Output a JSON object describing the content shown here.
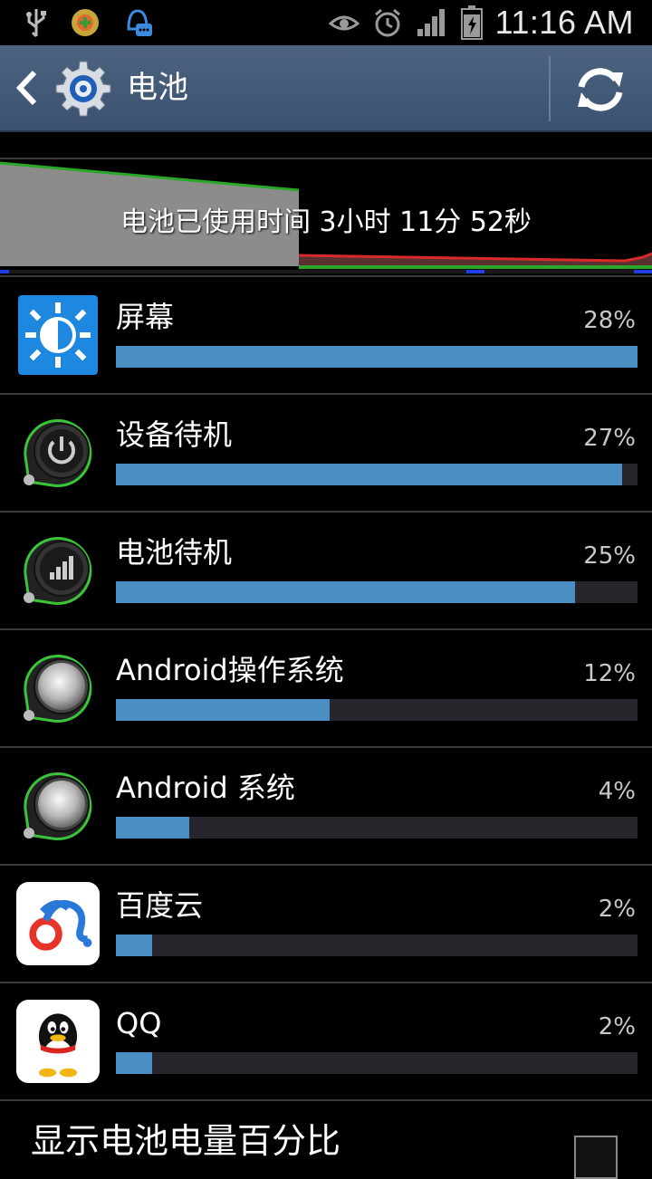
{
  "status_bar": {
    "time": "11:16 AM",
    "left_icons": [
      "usb-icon",
      "game-icon",
      "chat-bell-icon"
    ],
    "right_icons": [
      "eye-icon",
      "alarm-icon",
      "signal-icon",
      "battery-charging-icon"
    ]
  },
  "action_bar": {
    "title": "电池",
    "back_icon": "chevron-left-icon",
    "app_icon": "settings-gear-icon",
    "refresh_icon": "refresh-icon"
  },
  "battery_graph": {
    "usage_text": "电池已使用时间 3小时 11分 52秒"
  },
  "usage_items": [
    {
      "name": "屏幕",
      "percent_text": "28%",
      "fill": 1.0,
      "icon": "screen-brightness-icon"
    },
    {
      "name": "设备待机",
      "percent_text": "27%",
      "fill": 0.97,
      "icon": "power-icon"
    },
    {
      "name": "电池待机",
      "percent_text": "25%",
      "fill": 0.88,
      "icon": "signal-bars-icon"
    },
    {
      "name": "Android操作系统",
      "percent_text": "12%",
      "fill": 0.41,
      "icon": "android-os-icon"
    },
    {
      "name": "Android 系统",
      "percent_text": "4%",
      "fill": 0.14,
      "icon": "android-system-icon"
    },
    {
      "name": "百度云",
      "percent_text": "2%",
      "fill": 0.07,
      "icon": "baidu-cloud-icon"
    },
    {
      "name": "QQ",
      "percent_text": "2%",
      "fill": 0.07,
      "icon": "qq-penguin-icon"
    }
  ],
  "footer": {
    "show_percentage_label": "显示电池电量百分比",
    "checked": false
  },
  "colors": {
    "action_bar": "#3f5672",
    "bar_fill": "#4a8fc4",
    "bar_track": "#26262c",
    "graph_green": "#2aa82a",
    "graph_red": "#d82a2a"
  }
}
